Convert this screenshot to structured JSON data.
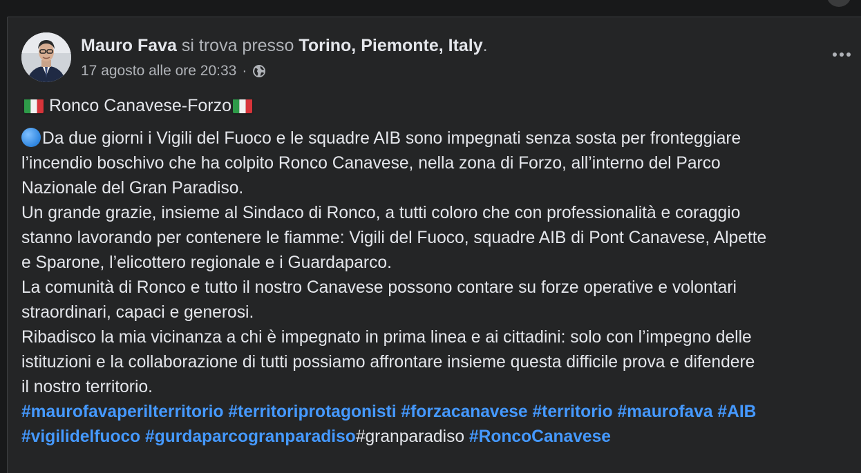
{
  "post": {
    "author": "Mauro Fava",
    "location_prefix": "si trova presso",
    "location": "Torino, Piemonte, Italy",
    "location_suffix": ".",
    "timestamp": "17 agosto alle ore 20:33",
    "separator": "·",
    "privacy_icon": "globe-icon",
    "title": "Ronco Canavese-Forzo",
    "paragraphs": {
      "p1": "Da due giorni i Vigili del Fuoco e le squadre AIB sono impegnati senza sosta per fronteggiare",
      "p2": "l’incendio boschivo che ha colpito Ronco Canavese, nella zona di Forzo, all’interno del Parco",
      "p3": "Nazionale del Gran Paradiso.",
      "p4": "Un grande grazie, insieme al Sindaco di Ronco, a tutti coloro che con professionalità e coraggio",
      "p5": "stanno lavorando per contenere le fiamme: Vigili del Fuoco, squadre AIB di Pont Canavese, Alpette",
      "p6": "e Sparone, l’elicottero regionale e i Guardaparco.",
      "p7": "La comunità di Ronco e tutto il nostro Canavese possono contare su forze operative e volontari",
      "p8": "straordinari, capaci e generosi.",
      "p9": "Ribadisco la mia vicinanza a chi è impegnato in prima linea e ai cittadini: solo con l’impegno delle",
      "p10": "istituzioni e la collaborazione di tutti possiamo affrontare insieme questa difficile prova e difendere",
      "p11": "il nostro territorio."
    },
    "hashtags": {
      "h1": "#maurofavaperilterritorio",
      "h2": "#territoriprotagonisti",
      "h3": "#forzacanavese",
      "h4": "#territorio",
      "h5": "#maurofava",
      "h6": "#AIB",
      "h7": "#vigilidelfuoco",
      "h8": "#gurdaparcogranparadiso",
      "h9": "#granparadiso",
      "h10": "#RoncoCanavese"
    }
  },
  "colors": {
    "background": "#18191a",
    "card": "#242526",
    "primary_text": "#e4e6eb",
    "secondary_text": "#b0b3b8",
    "hashtag": "#4599ff"
  }
}
